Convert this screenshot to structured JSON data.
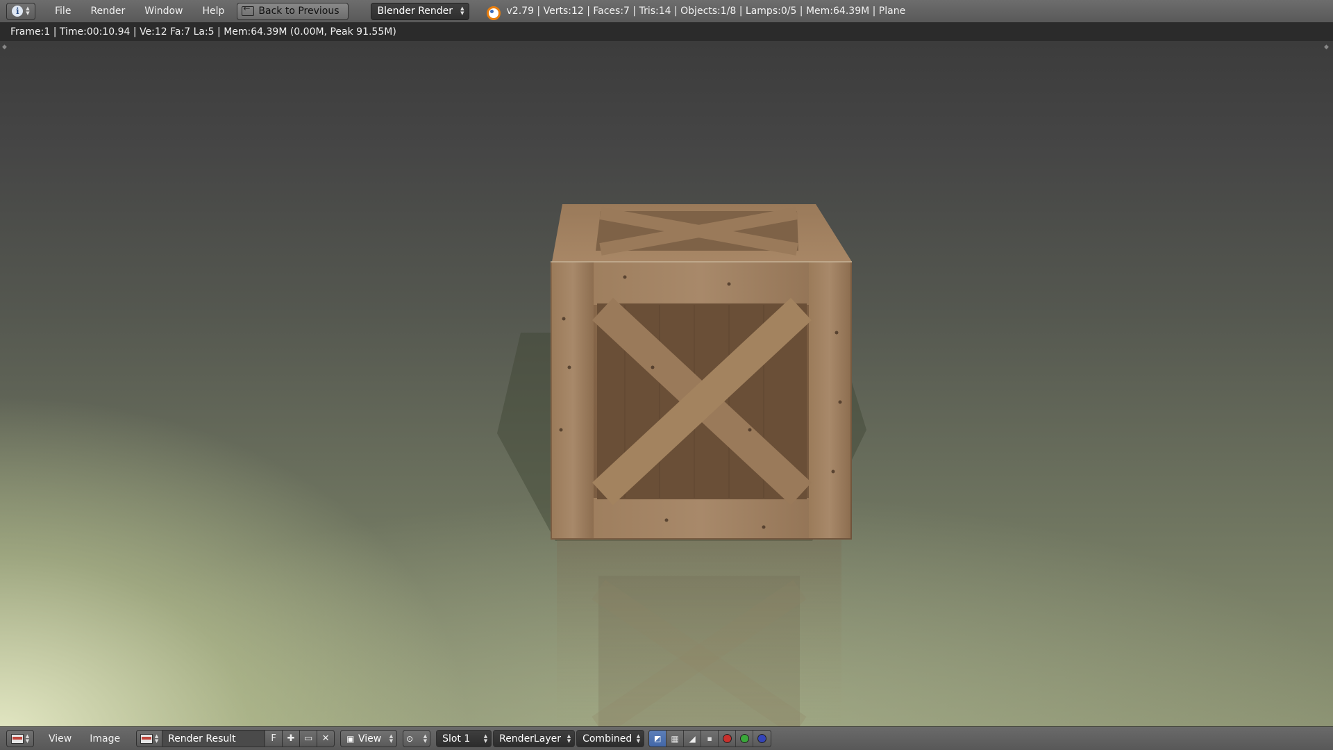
{
  "top_header": {
    "menu": [
      "File",
      "Render",
      "Window",
      "Help"
    ],
    "back_button": "Back to Previous",
    "render_engine": "Blender Render",
    "scene_stats": "v2.79 | Verts:12 | Faces:7 | Tris:14 | Objects:1/8 | Lamps:0/5 | Mem:64.39M | Plane"
  },
  "render_status": "Frame:1 | Time:00:10.94 | Ve:12 Fa:7 La:5 | Mem:64.39M (0.00M, Peak 91.55M)",
  "bottom_header": {
    "menu": [
      "View",
      "Image"
    ],
    "image_name": "Render Result",
    "fake_user_label": "F",
    "view_dropdown": "View",
    "slot": "Slot 1",
    "render_layer": "RenderLayer",
    "render_pass": "Combined"
  },
  "colors": {
    "accent_blue": "#4368a8",
    "channel_red": "#c9302c",
    "channel_green": "#3aa83a",
    "channel_blue": "#3444b8"
  }
}
